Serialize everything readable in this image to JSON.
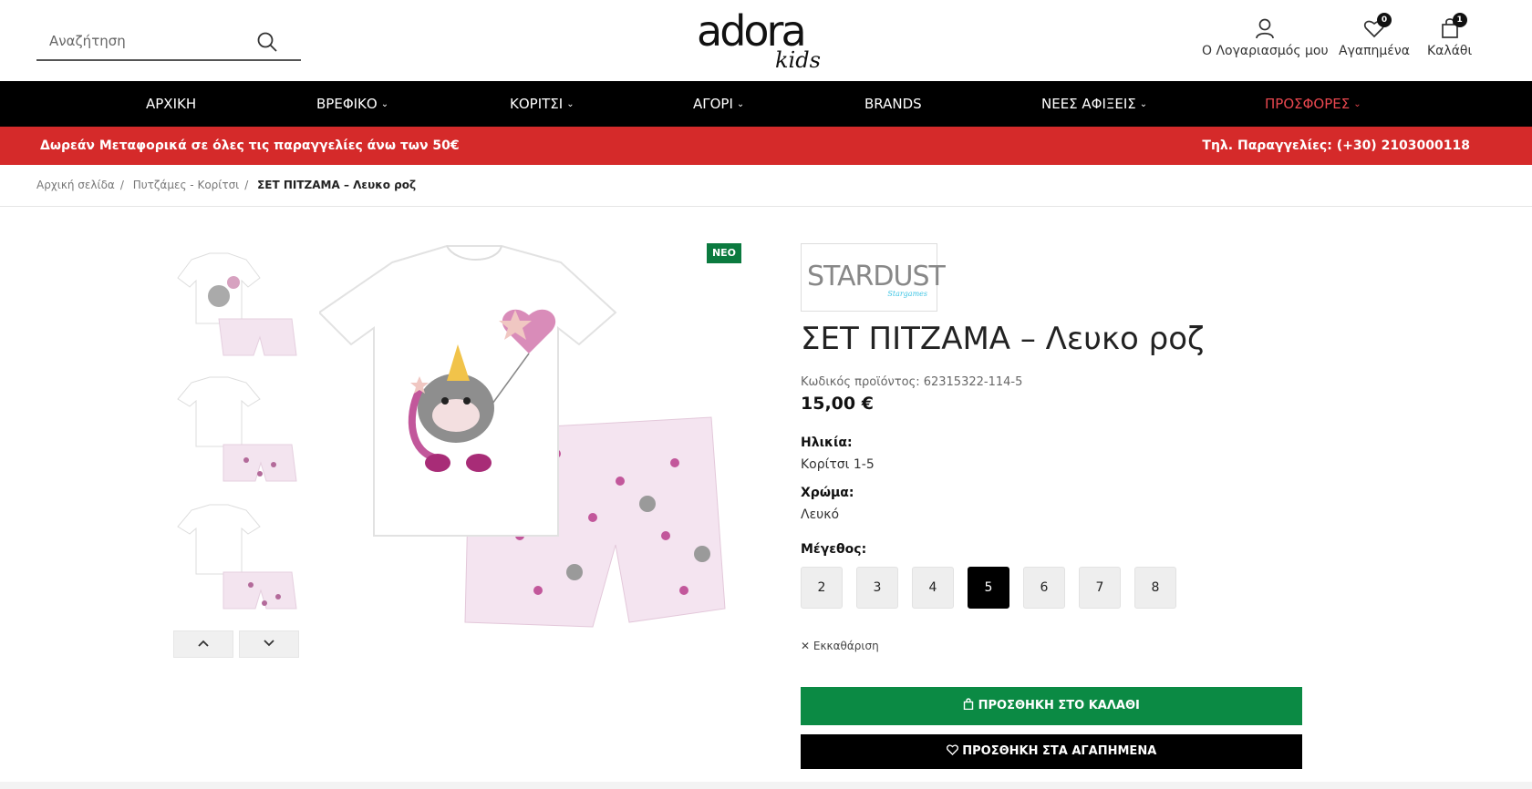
{
  "search": {
    "placeholder": "Αναζήτηση"
  },
  "logo": {
    "main": "adora",
    "sub": "kids"
  },
  "header_actions": {
    "account": "Ο Λογαριασμός μου",
    "wishlist": "Αγαπημένα",
    "wishlist_count": "0",
    "cart": "Καλάθι",
    "cart_count": "1"
  },
  "nav": {
    "items": [
      {
        "label": "ΑΡΧΙΚΗ"
      },
      {
        "label": "ΒΡΕΦΙΚΟ"
      },
      {
        "label": "ΚΟΡΙΤΣΙ"
      },
      {
        "label": "ΑΓΟΡΙ"
      },
      {
        "label": "BRANDS"
      },
      {
        "label": "ΝΕΕΣ ΑΦΙΞΕΙΣ"
      },
      {
        "label": "ΠΡΟΣΦΟΡΕΣ"
      }
    ],
    "highlight_color": "#e9474f"
  },
  "promo": {
    "left": "Δωρεάν Μεταφορικά σε όλες τις παραγγελίες άνω των 50€",
    "right": "Τηλ. Παραγγελίες: (+30) 2103000118",
    "bg_color": "#d52a2a"
  },
  "breadcrumb": {
    "home": "Αρχική σελίδα",
    "category": "Πυτζάμες - Κορίτσι",
    "current": "ΣΕΤ ΠΙΤΖΑΜΑ – Λευκο ροζ"
  },
  "gallery": {
    "badge": "ΝΕΟ",
    "prev_icon": "chevron-up-icon",
    "next_icon": "chevron-down-icon"
  },
  "product": {
    "brand": "STARDUST",
    "brand_tagline": "Stargames",
    "title": "ΣΕΤ ΠΙΤΖΑΜΑ – Λευκο ροζ",
    "sku_label": "Κωδικός προϊόντος:",
    "sku": "62315322-114-5",
    "price": "15,00 €",
    "age_label": "Ηλικία:",
    "age_value": "Κορίτσι 1-5",
    "color_label": "Χρώμα:",
    "color_value": "Λευκό",
    "size_label": "Μέγεθος:",
    "sizes": [
      "2",
      "3",
      "4",
      "5",
      "6",
      "7",
      "8"
    ],
    "selected_size": "5",
    "clear": "Εκκαθάριση",
    "add_to_cart": "ΠΡΟΣΘΗΚΗ ΣΤΟ ΚΑΛΑΘΙ",
    "add_to_wishlist": "ΠΡΟΣΘΗΚΗ ΣΤΑ ΑΓΑΠΗΜΕΝΑ",
    "cart_color": "#0b8a44"
  }
}
